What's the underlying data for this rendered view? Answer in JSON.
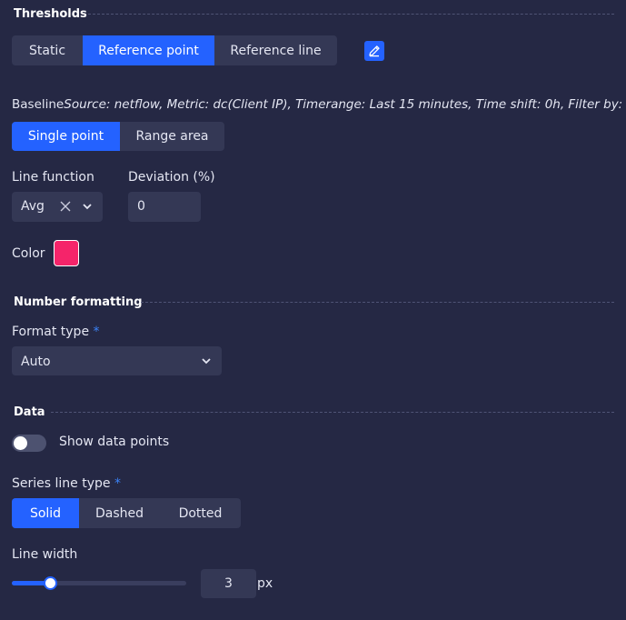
{
  "thresholds": {
    "title": "Thresholds",
    "tabs": [
      "Static",
      "Reference point",
      "Reference line"
    ],
    "active_tab": 1,
    "edit_icon": "pencil-icon"
  },
  "baseline": {
    "label": "Baseline",
    "source_text": "Source: netflow, Metric: dc(Client IP), Timerange: Last 15 minutes, Time shift: 0h, Filter by: none"
  },
  "point_mode": {
    "options": [
      "Single point",
      "Range area"
    ],
    "active": 0
  },
  "line_function": {
    "label": "Line function",
    "value": "Avg",
    "clear_icon": "close-icon",
    "dropdown_icon": "chevron-down-icon"
  },
  "deviation": {
    "label": "Deviation (%)",
    "value": "0"
  },
  "color": {
    "label": "Color",
    "value": "#f5246a"
  },
  "number_formatting": {
    "title": "Number formatting",
    "format_type_label": "Format type",
    "required_mark": "*",
    "format_type_value": "Auto"
  },
  "data": {
    "title": "Data",
    "show_data_points_label": "Show data points",
    "show_data_points": false,
    "series_line_type_label": "Series line type",
    "required_mark": "*",
    "line_types": [
      "Solid",
      "Dashed",
      "Dotted"
    ],
    "active_line_type": 0,
    "line_width_label": "Line width",
    "line_width_value": "3",
    "line_width_unit": "px",
    "line_width_slider_fraction": 0.22
  },
  "colors": {
    "background": "#252844",
    "control": "#343855",
    "accent": "#2462ff"
  }
}
